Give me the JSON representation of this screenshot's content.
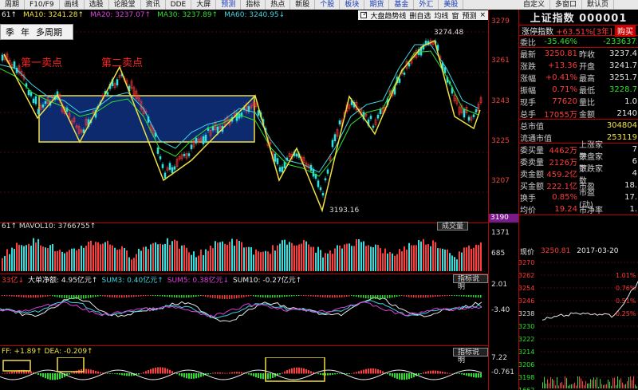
{
  "toolbar": {
    "items": [
      "周期",
      "F10/F9",
      "画线",
      "选股",
      "论股堂",
      "资讯",
      "DDE",
      "大屏",
      "预测",
      "指标",
      "热点",
      "新股"
    ],
    "right_items": [
      "个股",
      "板块",
      "期货",
      "基金",
      "外汇",
      "美股"
    ],
    "menu": [
      "自定义",
      "多窗口",
      "默认页"
    ]
  },
  "legend": {
    "prefix": "61↑",
    "ma10": "MA10: 3241.28↑",
    "ma20": "MA20: 3237.07↑",
    "ma30": "MA30: 3237.89↑",
    "ma60": "MA60: 3240.95↓",
    "trend_toggle": "大盘趋势线",
    "auto_select": "删自选",
    "avg": "均线",
    "window": "窗",
    "predict": "预测"
  },
  "period_popup": {
    "items": [
      "季",
      "年",
      "多周期"
    ]
  },
  "annotations": {
    "sell1": "第一卖点",
    "sell2": "第二卖点",
    "high": "3274.48",
    "low": "3193.16"
  },
  "price_axis": [
    "3279",
    "3261",
    "3243",
    "3225",
    "3207"
  ],
  "price_current": "3190",
  "volume": {
    "legend": "61↑ MAVOL10: 3766755↑",
    "button": "成交量",
    "axis": [
      "1371",
      "685"
    ]
  },
  "fund": {
    "prefix": "33亿↓",
    "big": "大单净额: 4.95亿元↑",
    "sum3": "SUM3: 0.40亿元↑",
    "sum5": "SUM5: 0.38亿元↓",
    "sum10": "SUM10: -0.27亿元↑",
    "button": "指标说明",
    "axis": [
      "2.01",
      "-3.40"
    ]
  },
  "macd": {
    "legend": "FF: +1.89↑ DEA: -0.209↑",
    "button": "指标说明",
    "axis": [
      "7.22",
      "-0.761"
    ]
  },
  "panel": {
    "title": "上证指数 000001",
    "sub_label": "涨停指数",
    "sub_value": "+63.51%[3年]",
    "buy_btn": "购买",
    "rows": [
      {
        "l": "委比",
        "v": "-35.46%",
        "l2": "",
        "v2": "-2336375"
      },
      {
        "l": "最新",
        "v": "3250.81",
        "l2": "昨收",
        "v2": "3237.4"
      },
      {
        "l": "涨跌",
        "v": "+13.36",
        "l2": "开盘",
        "v2": "3241.7"
      },
      {
        "l": "涨幅",
        "v": "+0.41%",
        "l2": "最高",
        "v2": "3251.7"
      },
      {
        "l": "振幅",
        "v": "0.71%",
        "l2": "最低",
        "v2": "3228.7"
      },
      {
        "l": "现手",
        "v": "77620",
        "l2": "量比",
        "v2": "1.0"
      },
      {
        "l": "总手",
        "v": "17055万",
        "l2": "金额",
        "v2": "2140"
      },
      {
        "l": "总市值",
        "v": "",
        "l2": "",
        "v2": "304804"
      },
      {
        "l": "流通市值",
        "v": "",
        "l2": "",
        "v2": "253119"
      },
      {
        "l": "委买量",
        "v": "4462万",
        "l2": "上涨家数",
        "v2": "7"
      },
      {
        "l": "委卖量",
        "v": "2126万",
        "l2": "平盘家数",
        "v2": "6"
      },
      {
        "l": "卖金额",
        "v": "459.2亿",
        "l2": "下跌家数",
        "v2": "4"
      },
      {
        "l": "买金额",
        "v": "222.1亿",
        "l2": "市盈",
        "v2": "18."
      },
      {
        "l": "换手",
        "v": "0.85%",
        "l2": "市盈(动)",
        "v2": "17."
      },
      {
        "l": "均价",
        "v": "19.24",
        "l2": "市净率",
        "v2": "1."
      }
    ],
    "mini_label": "现价",
    "mini_price": "3250.81",
    "mini_date": "2017-03-20",
    "mini_axis": [
      "3270",
      "3262",
      "3254",
      "3246",
      "3238",
      "3230",
      "3222",
      "3214",
      "3206",
      "3198",
      "1662"
    ],
    "mini_pct": [
      "1.01%",
      "0.76%",
      "0.51%",
      "0.25%"
    ]
  }
}
